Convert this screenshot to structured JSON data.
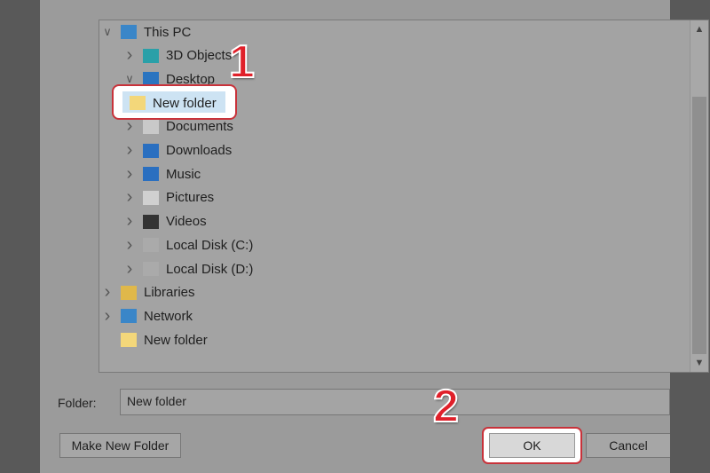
{
  "tree": [
    {
      "label": "This PC",
      "icon": "pc-icon",
      "expand": "expanded",
      "level": 0
    },
    {
      "label": "3D Objects",
      "icon": "3d-objects-icon",
      "expand": "collapsed",
      "level": 1
    },
    {
      "label": "Desktop",
      "icon": "desktop-icon",
      "expand": "expanded",
      "level": 1
    },
    {
      "label": "New folder",
      "icon": "folder-icon",
      "expand": "none",
      "level": 2,
      "selected": true
    },
    {
      "label": "Documents",
      "icon": "documents-icon",
      "expand": "collapsed",
      "level": 1
    },
    {
      "label": "Downloads",
      "icon": "downloads-icon",
      "expand": "collapsed",
      "level": 1
    },
    {
      "label": "Music",
      "icon": "music-icon",
      "expand": "collapsed",
      "level": 1
    },
    {
      "label": "Pictures",
      "icon": "pictures-icon",
      "expand": "collapsed",
      "level": 1
    },
    {
      "label": "Videos",
      "icon": "videos-icon",
      "expand": "collapsed",
      "level": 1
    },
    {
      "label": "Local Disk (C:)",
      "icon": "drive-icon",
      "expand": "collapsed",
      "level": 1
    },
    {
      "label": "Local Disk (D:)",
      "icon": "drive-icon",
      "expand": "collapsed",
      "level": 1
    },
    {
      "label": "Libraries",
      "icon": "libraries-icon",
      "expand": "collapsed",
      "level": 0
    },
    {
      "label": "Network",
      "icon": "network-icon",
      "expand": "collapsed",
      "level": 0
    },
    {
      "label": "New folder",
      "icon": "folder-icon",
      "expand": "none",
      "level": 0
    }
  ],
  "folder": {
    "label": "Folder:",
    "value": "New folder"
  },
  "buttons": {
    "make_new": "Make New Folder",
    "ok": "OK",
    "cancel": "Cancel"
  },
  "annotations": {
    "step1": "1",
    "step2": "2"
  },
  "colors": {
    "annotation": "#e0202a",
    "selection": "#cde3f3"
  }
}
